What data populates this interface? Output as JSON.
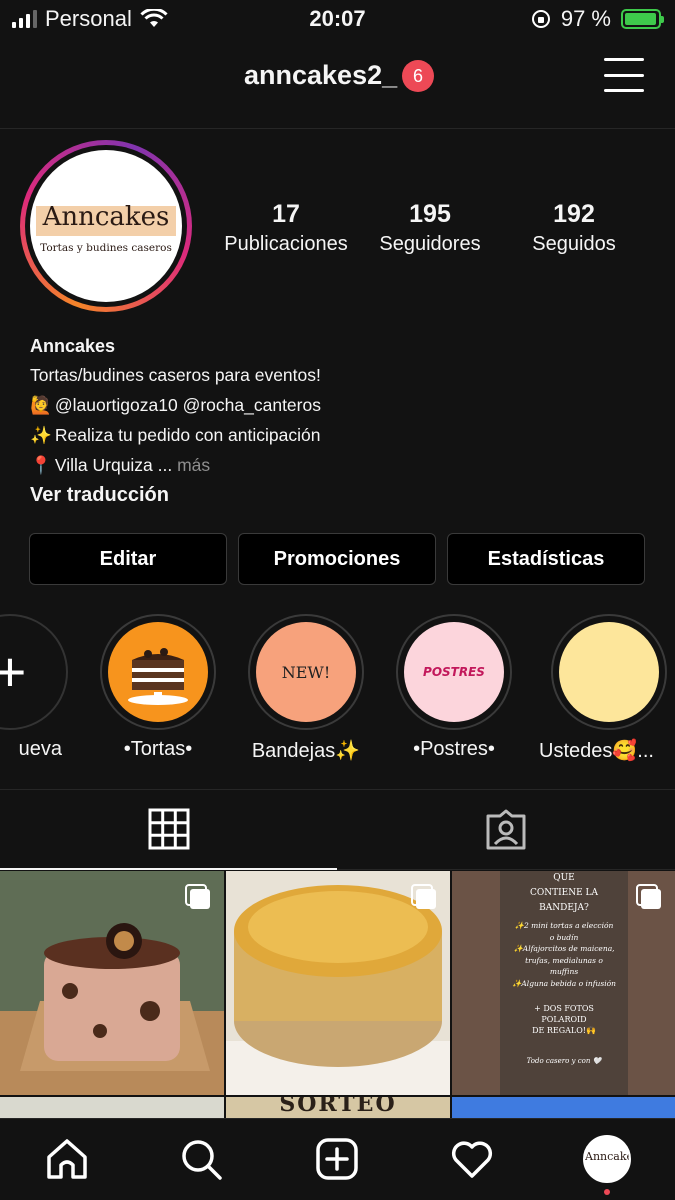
{
  "status": {
    "carrier": "Personal",
    "time": "20:07",
    "battery": "97 %",
    "battery_level": 0.97
  },
  "header": {
    "username": "anncakes2_",
    "notifications": "6"
  },
  "profile": {
    "logo_title": "Anncakes",
    "logo_subtitle": "Tortas y budines caseros",
    "stats": [
      {
        "value": "17",
        "label": "Publicaciones"
      },
      {
        "value": "195",
        "label": "Seguidores"
      },
      {
        "value": "192",
        "label": "Seguidos"
      }
    ],
    "name": "Anncakes",
    "bio_lines": [
      {
        "emoji": "",
        "text": "Tortas/budines caseros para eventos!"
      },
      {
        "emoji": "🙋",
        "text": "@lauortigoza10 @rocha_canteros"
      },
      {
        "emoji": "✨",
        "text": "Realiza tu pedido con anticipación"
      },
      {
        "emoji": "📍",
        "text": "Villa Urquiza ... "
      }
    ],
    "more": "más",
    "translate": "Ver traducción"
  },
  "buttons": {
    "edit": "Editar",
    "promotions": "Promociones",
    "insights": "Estadísticas"
  },
  "highlights": [
    {
      "label": "ueva",
      "icon": "plus-icon"
    },
    {
      "label": "•Tortas•",
      "color": "#f7941d"
    },
    {
      "label": "Bandejas✨",
      "text": "NEW!",
      "color": "#f7a27c"
    },
    {
      "label": "•Postres•",
      "text": "POSTRES",
      "color": "#fcd5dc"
    },
    {
      "label": "Ustedes🥰...",
      "color": "#fde69b"
    }
  ],
  "posts": {
    "third_post_text": [
      "QUE",
      "CONTIENE LA",
      "BANDEJA?",
      "✨2 mini tortas a elección",
      "o budín",
      "✨Alfajorcitos de maicena,",
      "trufas, medialunas o",
      "muffins",
      "✨Alguna bebida o infusión",
      "+ DOS FOTOS",
      "POLAROID",
      "DE REGALO!🙌",
      "Todo casero y con 🤍"
    ],
    "second_row_text": "SORTEO"
  },
  "icons": {
    "home": "home-icon",
    "search": "search-icon",
    "new_post": "plus-square-icon",
    "activity": "heart-icon",
    "grid": "grid-icon",
    "tagged": "tagged-person-icon"
  }
}
